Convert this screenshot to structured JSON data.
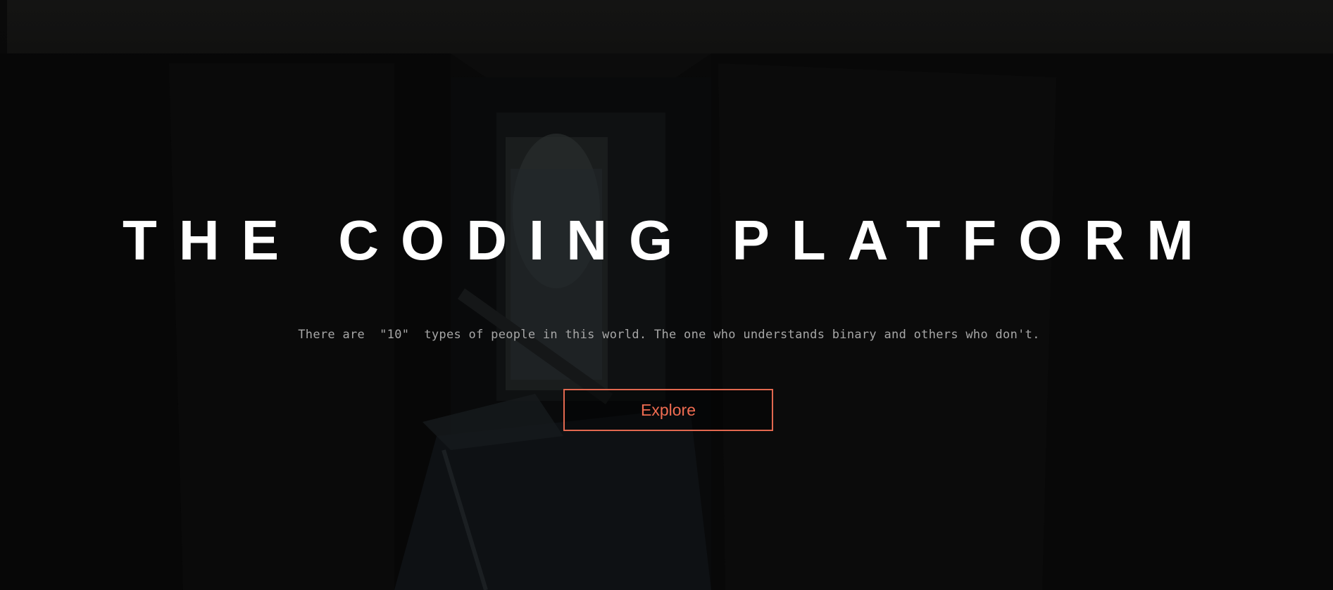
{
  "hero": {
    "title": "THE CODING PLATFORM",
    "tagline": "There are  \"10\"  types of people in this world. The one who understands binary and others who don't.",
    "explore_label": "Explore"
  },
  "colors": {
    "accent": "#e2684f",
    "title": "#ffffff",
    "tagline": "#a7a7a7",
    "background": "#050505"
  }
}
